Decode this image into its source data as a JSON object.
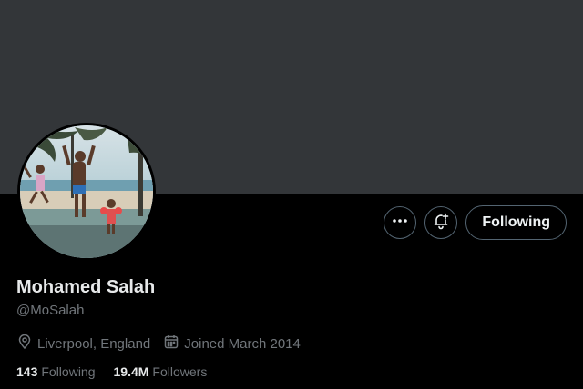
{
  "profile": {
    "name": "Mohamed Salah",
    "handle": "@MoSalah",
    "location": "Liverpool, England",
    "joined": "Joined March 2014",
    "following_count": "143",
    "following_label": "Following",
    "followers_count": "19.4M",
    "followers_label": "Followers"
  },
  "actions": {
    "more_icon": "more-horizontal-icon",
    "notify_icon": "bell-plus-icon",
    "follow_label": "Following"
  },
  "icons": {
    "location": "map-pin-icon",
    "calendar": "calendar-icon"
  },
  "colors": {
    "banner": "#333639",
    "background": "#000000",
    "primary_text": "#e7e9ea",
    "secondary_text": "#71767b",
    "button_border": "#536471"
  }
}
